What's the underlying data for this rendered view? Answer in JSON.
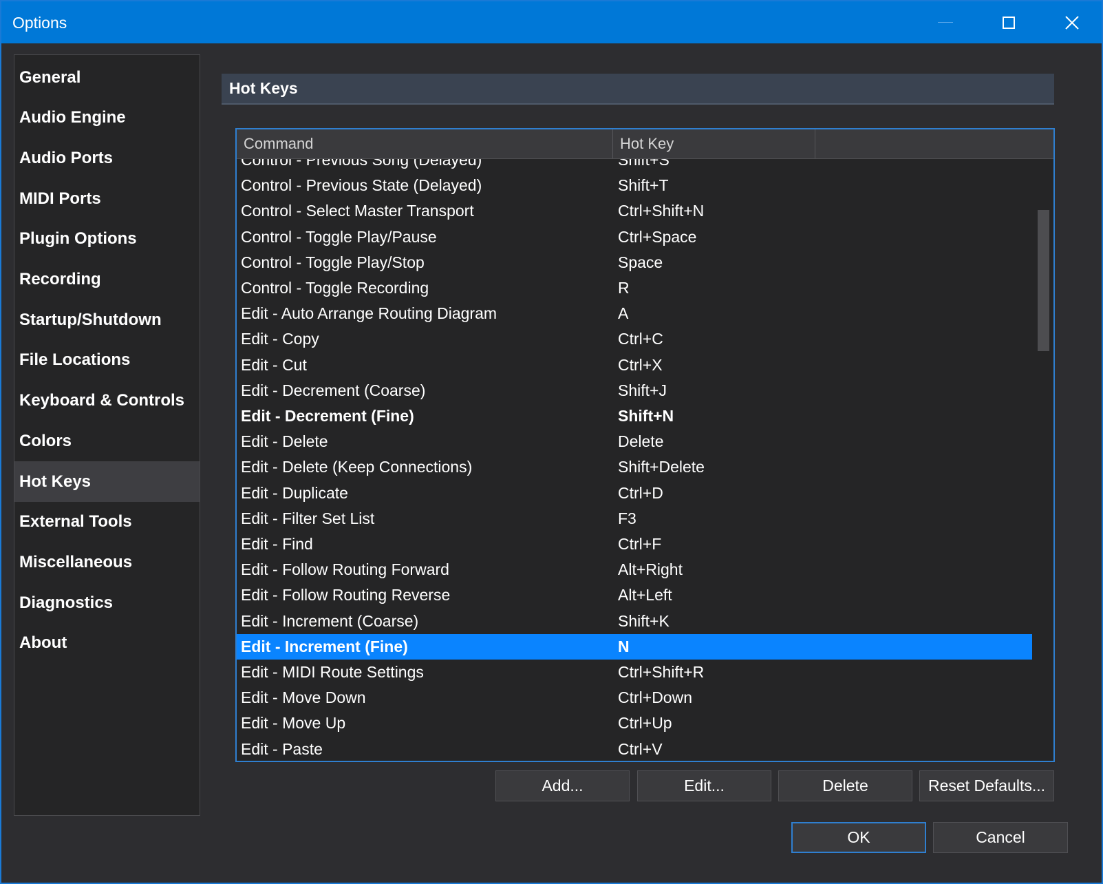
{
  "window": {
    "title": "Options"
  },
  "sidebar": {
    "items": [
      {
        "label": "General"
      },
      {
        "label": "Audio Engine"
      },
      {
        "label": "Audio Ports"
      },
      {
        "label": "MIDI Ports"
      },
      {
        "label": "Plugin Options"
      },
      {
        "label": "Recording"
      },
      {
        "label": "Startup/Shutdown"
      },
      {
        "label": "File Locations"
      },
      {
        "label": "Keyboard & Controls"
      },
      {
        "label": "Colors"
      },
      {
        "label": "Hot Keys",
        "active": true
      },
      {
        "label": "External Tools"
      },
      {
        "label": "Miscellaneous"
      },
      {
        "label": "Diagnostics"
      },
      {
        "label": "About"
      }
    ]
  },
  "section": {
    "title": "Hot Keys"
  },
  "grid": {
    "columns": [
      "Command",
      "Hot Key"
    ],
    "rows": [
      {
        "command": "Control - Previous Song (Delayed)",
        "hotkey": "Shift+S"
      },
      {
        "command": "Control - Previous State (Delayed)",
        "hotkey": "Shift+T"
      },
      {
        "command": "Control - Select Master Transport",
        "hotkey": "Ctrl+Shift+N"
      },
      {
        "command": "Control - Toggle Play/Pause",
        "hotkey": "Ctrl+Space"
      },
      {
        "command": "Control - Toggle Play/Stop",
        "hotkey": "Space"
      },
      {
        "command": "Control - Toggle Recording",
        "hotkey": "R"
      },
      {
        "command": "Edit - Auto Arrange Routing Diagram",
        "hotkey": "A"
      },
      {
        "command": "Edit - Copy",
        "hotkey": "Ctrl+C"
      },
      {
        "command": "Edit - Cut",
        "hotkey": "Ctrl+X"
      },
      {
        "command": "Edit - Decrement (Coarse)",
        "hotkey": "Shift+J"
      },
      {
        "command": "Edit - Decrement (Fine)",
        "hotkey": "Shift+N",
        "bold": true
      },
      {
        "command": "Edit - Delete",
        "hotkey": "Delete"
      },
      {
        "command": "Edit - Delete (Keep Connections)",
        "hotkey": "Shift+Delete"
      },
      {
        "command": "Edit - Duplicate",
        "hotkey": "Ctrl+D"
      },
      {
        "command": "Edit - Filter Set List",
        "hotkey": "F3"
      },
      {
        "command": "Edit - Find",
        "hotkey": "Ctrl+F"
      },
      {
        "command": "Edit - Follow Routing Forward",
        "hotkey": "Alt+Right"
      },
      {
        "command": "Edit - Follow Routing Reverse",
        "hotkey": "Alt+Left"
      },
      {
        "command": "Edit - Increment (Coarse)",
        "hotkey": "Shift+K"
      },
      {
        "command": "Edit - Increment (Fine)",
        "hotkey": "N",
        "selected": true
      },
      {
        "command": "Edit - MIDI Route Settings",
        "hotkey": "Ctrl+Shift+R"
      },
      {
        "command": "Edit - Move Down",
        "hotkey": "Ctrl+Down"
      },
      {
        "command": "Edit - Move Up",
        "hotkey": "Ctrl+Up"
      },
      {
        "command": "Edit - Paste",
        "hotkey": "Ctrl+V"
      }
    ]
  },
  "actions": {
    "add": "Add...",
    "edit": "Edit...",
    "delete": "Delete",
    "reset": "Reset Defaults..."
  },
  "dialog": {
    "ok": "OK",
    "cancel": "Cancel"
  },
  "colors": {
    "accent": "#0078d7",
    "selection": "#0a84ff"
  }
}
